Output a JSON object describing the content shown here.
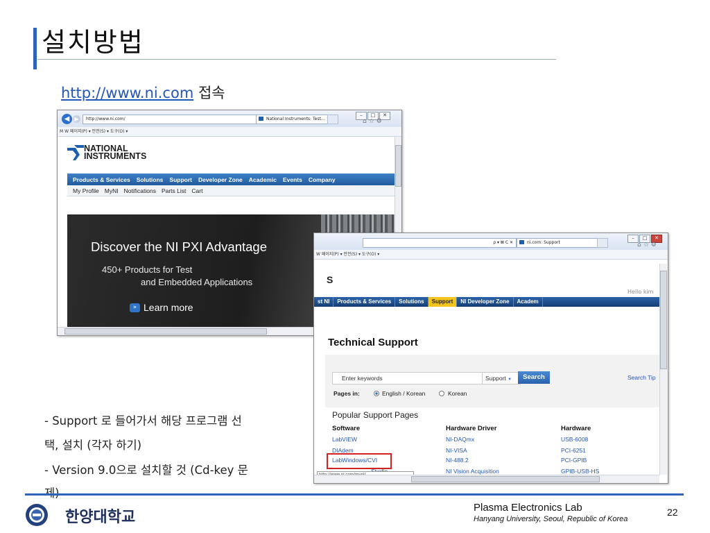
{
  "slide": {
    "title": "설치방법",
    "url_link": "http://www.ni.com",
    "url_suffix": "접속",
    "notes": [
      "- Support 로 들어가서 해당 프로그램 선",
      "택,  설치 (각자 하기)",
      "- Version 9.0으로 설치할 것 (Cd-key 문",
      "제)"
    ],
    "page_number": "22"
  },
  "footer": {
    "university": "한양대학교",
    "lab_name": "Plasma Electronics Lab",
    "lab_subtitle": "Hanyang University, Seoul, Republic of Korea"
  },
  "window1": {
    "address": "http://www.ni.com/",
    "tab_title": "National Instruments: Test...",
    "favorites_text": "M W  페이지(P) ▾  안전(S) ▾  도구(O) ▾",
    "logo_line1": "NATIONAL",
    "logo_line2": "INSTRUMENTS",
    "nav": [
      "Products & Services",
      "Solutions",
      "Support",
      "Developer Zone",
      "Academic",
      "Events",
      "Company"
    ],
    "subnav": [
      "My Profile",
      "MyNI",
      "Notifications",
      "Parts List",
      "Cart"
    ],
    "hero_title": "Discover the NI PXI Advantage",
    "hero_line1": "450+ Products for Test",
    "hero_line2": "and Embedded Applications",
    "hero_link": "Learn more"
  },
  "window2": {
    "address": "ρ ▾ ⊠ C ✕",
    "tab_title": "ni.com: Support",
    "favorites_text": "W  페이지(P) ▾  안전(S) ▾  도구(O) ▾",
    "logo_fragment": "S",
    "hello_text": "Hello kim",
    "nav": [
      "st NI",
      "Products & Services",
      "Solutions",
      "Support",
      "NI Developer Zone",
      "Academ"
    ],
    "page_title": "Technical Support",
    "search_placeholder": "Enter keywords",
    "search_scope": "Support",
    "search_button": "Search",
    "search_tip": "Search Tip",
    "pages_in_label": "Pages in:",
    "radio_options": [
      "English / Korean",
      "Korean"
    ],
    "popular_title": "Popular Support Pages",
    "columns": [
      "Software",
      "Hardware Driver",
      "Hardware"
    ],
    "rows": [
      [
        "LabVIEW",
        "NI-DAQmx",
        "USB-6008"
      ],
      [
        "DIAdem",
        "NI-VISA",
        "PCI-6251"
      ],
      [
        "LabWindows/CVI",
        "NI-488.2",
        "PCI-GPIB"
      ],
      [
        "Studio",
        "NI Vision Acquisition",
        "GPIB-USB-HS"
      ]
    ],
    "status_url": "http://www.ni.com/mynl/"
  }
}
